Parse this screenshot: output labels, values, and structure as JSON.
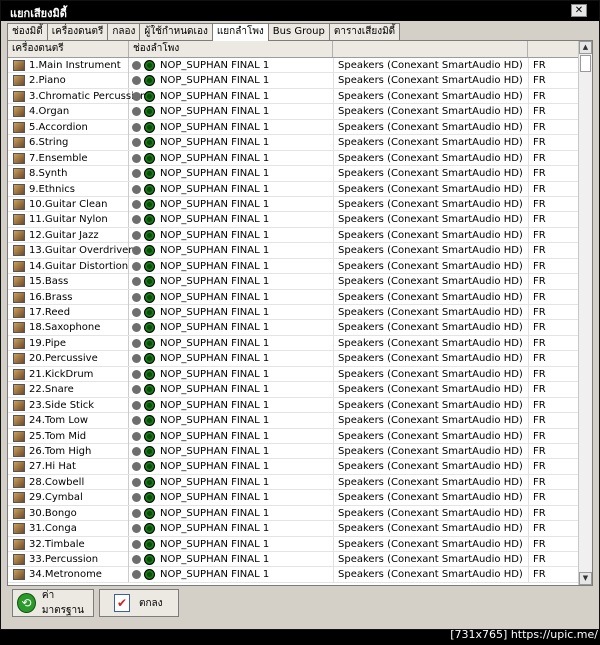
{
  "window": {
    "title": "แยกเสียงมิดี้",
    "close_glyph": "✕"
  },
  "tabs": [
    "ช่องมิดี้",
    "เครื่องดนตรี",
    "กลอง",
    "ผู้ใช้กำหนดเอง",
    "แยกลำโพง",
    "Bus Group",
    "ตารางเสียงมิดี้"
  ],
  "active_tab": "แยกลำโพง",
  "table": {
    "headers": [
      "เครื่องดนตรี",
      "ช่องลำโพง",
      "",
      ""
    ],
    "rows": [
      {
        "instrument": "1.Main Instrument",
        "port": "NOP_SUPHAN FINAL 1",
        "device": "Speakers (Conexant SmartAudio HD)",
        "channel": "FR"
      },
      {
        "instrument": "2.Piano",
        "port": "NOP_SUPHAN FINAL 1",
        "device": "Speakers (Conexant SmartAudio HD)",
        "channel": "FR"
      },
      {
        "instrument": "3.Chromatic Percussion",
        "port": "NOP_SUPHAN FINAL 1",
        "device": "Speakers (Conexant SmartAudio HD)",
        "channel": "FR"
      },
      {
        "instrument": "4.Organ",
        "port": "NOP_SUPHAN FINAL 1",
        "device": "Speakers (Conexant SmartAudio HD)",
        "channel": "FR"
      },
      {
        "instrument": "5.Accordion",
        "port": "NOP_SUPHAN FINAL 1",
        "device": "Speakers (Conexant SmartAudio HD)",
        "channel": "FR"
      },
      {
        "instrument": "6.String",
        "port": "NOP_SUPHAN FINAL 1",
        "device": "Speakers (Conexant SmartAudio HD)",
        "channel": "FR"
      },
      {
        "instrument": "7.Ensemble",
        "port": "NOP_SUPHAN FINAL 1",
        "device": "Speakers (Conexant SmartAudio HD)",
        "channel": "FR"
      },
      {
        "instrument": "8.Synth",
        "port": "NOP_SUPHAN FINAL 1",
        "device": "Speakers (Conexant SmartAudio HD)",
        "channel": "FR"
      },
      {
        "instrument": "9.Ethnics",
        "port": "NOP_SUPHAN FINAL 1",
        "device": "Speakers (Conexant SmartAudio HD)",
        "channel": "FR"
      },
      {
        "instrument": "10.Guitar Clean",
        "port": "NOP_SUPHAN FINAL 1",
        "device": "Speakers (Conexant SmartAudio HD)",
        "channel": "FR"
      },
      {
        "instrument": "11.Guitar Nylon",
        "port": "NOP_SUPHAN FINAL 1",
        "device": "Speakers (Conexant SmartAudio HD)",
        "channel": "FR"
      },
      {
        "instrument": "12.Guitar Jazz",
        "port": "NOP_SUPHAN FINAL 1",
        "device": "Speakers (Conexant SmartAudio HD)",
        "channel": "FR"
      },
      {
        "instrument": "13.Guitar Overdriven",
        "port": "NOP_SUPHAN FINAL 1",
        "device": "Speakers (Conexant SmartAudio HD)",
        "channel": "FR"
      },
      {
        "instrument": "14.Guitar Distortion",
        "port": "NOP_SUPHAN FINAL 1",
        "device": "Speakers (Conexant SmartAudio HD)",
        "channel": "FR"
      },
      {
        "instrument": "15.Bass",
        "port": "NOP_SUPHAN FINAL 1",
        "device": "Speakers (Conexant SmartAudio HD)",
        "channel": "FR"
      },
      {
        "instrument": "16.Brass",
        "port": "NOP_SUPHAN FINAL 1",
        "device": "Speakers (Conexant SmartAudio HD)",
        "channel": "FR"
      },
      {
        "instrument": "17.Reed",
        "port": "NOP_SUPHAN FINAL 1",
        "device": "Speakers (Conexant SmartAudio HD)",
        "channel": "FR"
      },
      {
        "instrument": "18.Saxophone",
        "port": "NOP_SUPHAN FINAL 1",
        "device": "Speakers (Conexant SmartAudio HD)",
        "channel": "FR"
      },
      {
        "instrument": "19.Pipe",
        "port": "NOP_SUPHAN FINAL 1",
        "device": "Speakers (Conexant SmartAudio HD)",
        "channel": "FR"
      },
      {
        "instrument": "20.Percussive",
        "port": "NOP_SUPHAN FINAL 1",
        "device": "Speakers (Conexant SmartAudio HD)",
        "channel": "FR"
      },
      {
        "instrument": "21.KickDrum",
        "port": "NOP_SUPHAN FINAL 1",
        "device": "Speakers (Conexant SmartAudio HD)",
        "channel": "FR"
      },
      {
        "instrument": "22.Snare",
        "port": "NOP_SUPHAN FINAL 1",
        "device": "Speakers (Conexant SmartAudio HD)",
        "channel": "FR"
      },
      {
        "instrument": "23.Side Stick",
        "port": "NOP_SUPHAN FINAL 1",
        "device": "Speakers (Conexant SmartAudio HD)",
        "channel": "FR"
      },
      {
        "instrument": "24.Tom Low",
        "port": "NOP_SUPHAN FINAL 1",
        "device": "Speakers (Conexant SmartAudio HD)",
        "channel": "FR"
      },
      {
        "instrument": "25.Tom Mid",
        "port": "NOP_SUPHAN FINAL 1",
        "device": "Speakers (Conexant SmartAudio HD)",
        "channel": "FR"
      },
      {
        "instrument": "26.Tom High",
        "port": "NOP_SUPHAN FINAL 1",
        "device": "Speakers (Conexant SmartAudio HD)",
        "channel": "FR"
      },
      {
        "instrument": "27.Hi Hat",
        "port": "NOP_SUPHAN FINAL 1",
        "device": "Speakers (Conexant SmartAudio HD)",
        "channel": "FR"
      },
      {
        "instrument": "28.Cowbell",
        "port": "NOP_SUPHAN FINAL 1",
        "device": "Speakers (Conexant SmartAudio HD)",
        "channel": "FR"
      },
      {
        "instrument": "29.Cymbal",
        "port": "NOP_SUPHAN FINAL 1",
        "device": "Speakers (Conexant SmartAudio HD)",
        "channel": "FR"
      },
      {
        "instrument": "30.Bongo",
        "port": "NOP_SUPHAN FINAL 1",
        "device": "Speakers (Conexant SmartAudio HD)",
        "channel": "FR"
      },
      {
        "instrument": "31.Conga",
        "port": "NOP_SUPHAN FINAL 1",
        "device": "Speakers (Conexant SmartAudio HD)",
        "channel": "FR"
      },
      {
        "instrument": "32.Timbale",
        "port": "NOP_SUPHAN FINAL 1",
        "device": "Speakers (Conexant SmartAudio HD)",
        "channel": "FR"
      },
      {
        "instrument": "33.Percussion",
        "port": "NOP_SUPHAN FINAL 1",
        "device": "Speakers (Conexant SmartAudio HD)",
        "channel": "FR"
      },
      {
        "instrument": "34.Metronome",
        "port": "NOP_SUPHAN FINAL 1",
        "device": "Speakers (Conexant SmartAudio HD)",
        "channel": "FR"
      }
    ]
  },
  "buttons": {
    "default_label": "ค่ามาตรฐาน",
    "ok_label": "ตกลง"
  },
  "icons": {
    "scroll_up": "▲",
    "scroll_down": "▼",
    "default_icon": "⟲",
    "ok_icon": "✔"
  },
  "watermark": "[731x765] https://upic.me/"
}
